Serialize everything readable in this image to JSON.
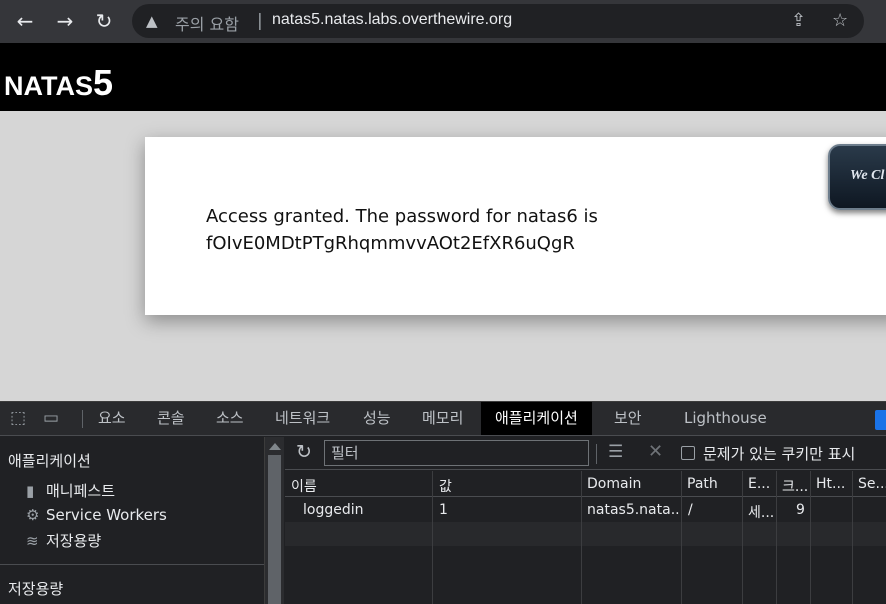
{
  "browser": {
    "security_label": "주의 요함",
    "separator": "|",
    "url": "natas5.natas.labs.overthewire.org"
  },
  "page": {
    "logo_text": "NATAS",
    "logo_number": "5",
    "message_line1": "Access granted. The password for natas6 is",
    "message_line2": "fOIvE0MDtPTgRhqmmvvAOt2EfXR6uQgR",
    "badge_text": "We Cl"
  },
  "devtools": {
    "tabs": [
      "요소",
      "콘솔",
      "소스",
      "네트워크",
      "성능",
      "메모리",
      "애플리케이션",
      "보안",
      "Lighthouse"
    ],
    "active_tab": "애플리케이션",
    "sidebar": {
      "app_heading": "애플리케이션",
      "items": [
        {
          "label": "매니페스트",
          "icon": "document-icon"
        },
        {
          "label": "Service Workers",
          "icon": "gear-icon"
        },
        {
          "label": "저장용량",
          "icon": "database-icon"
        }
      ],
      "storage_heading": "저장용량"
    },
    "filter": {
      "placeholder": "필터",
      "issues_only_label": "문제가 있는 쿠키만 표시",
      "issues_only_checked": false
    },
    "cookies": {
      "columns": [
        "이름",
        "값",
        "Domain",
        "Path",
        "E...",
        "크...",
        "Ht...",
        "Se..."
      ],
      "rows": [
        {
          "name": "loggedin",
          "value": "1",
          "domain": "natas5.nata...",
          "path": "/",
          "expires": "세...",
          "size": "9",
          "httponly": "",
          "secure": ""
        }
      ]
    }
  }
}
